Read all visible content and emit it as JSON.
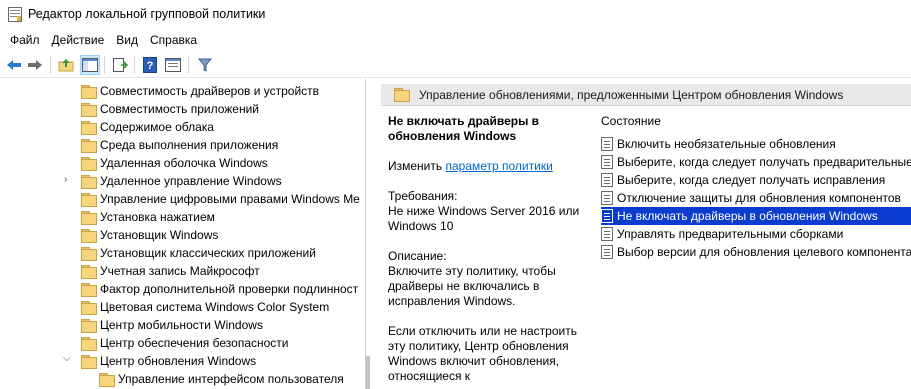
{
  "window": {
    "title": "Редактор локальной групповой политики"
  },
  "menu": {
    "items": [
      "Файл",
      "Действие",
      "Вид",
      "Справка"
    ]
  },
  "toolbar": {
    "buttons": [
      "back-icon",
      "forward-icon",
      "up-folder-icon",
      "show-hide-tree-icon",
      "export-list-icon",
      "help-icon",
      "properties-icon",
      "filter-icon"
    ]
  },
  "tree": {
    "items": [
      {
        "label": "Совместимость драйверов и устройств"
      },
      {
        "label": "Совместимость приложений"
      },
      {
        "label": "Содержимое облака"
      },
      {
        "label": "Среда выполнения приложения"
      },
      {
        "label": "Удаленная оболочка Windows"
      },
      {
        "label": "Удаленное управление Windows"
      },
      {
        "label": "Управление цифровыми правами Windows Me"
      },
      {
        "label": "Установка нажатием"
      },
      {
        "label": "Установщик Windows"
      },
      {
        "label": "Установщик классических приложений"
      },
      {
        "label": "Учетная запись Майкрософт"
      },
      {
        "label": "Фактор дополнительной проверки подлинност"
      },
      {
        "label": "Цветовая система Windows Color System"
      },
      {
        "label": "Центр мобильности Windows"
      },
      {
        "label": "Центр обеспечения безопасности"
      },
      {
        "label": "Центр обновления Windows"
      },
      {
        "label": "Управление интерфейсом пользователя"
      }
    ]
  },
  "right": {
    "header": "Управление обновлениями, предложенными Центром обновления Windows",
    "policy_title": "Не включать драйверы в обновления Windows",
    "edit_prefix": "Изменить ",
    "edit_link": "параметр политики",
    "requirements_label": "Требования:",
    "requirements_text": "Не ниже Windows Server 2016 или Windows 10",
    "description_label": "Описание:",
    "description_text": "Включите эту политику, чтобы драйверы не включались в исправления Windows.",
    "description_more": "Если отключить или не настроить эту политику, Центр обновления Windows включит обновления, относящиеся к",
    "state_header": "Состояние",
    "policies": [
      {
        "label": "Включить необязательные обновления"
      },
      {
        "label": "Выберите, когда следует получать предварительные"
      },
      {
        "label": "Выберите, когда следует получать исправления"
      },
      {
        "label": "Отключение защиты для обновления компонентов"
      },
      {
        "label": "Не включать драйверы в обновления Windows"
      },
      {
        "label": "Управлять предварительными сборками"
      },
      {
        "label": "Выбор версии для обновления целевого компонента"
      }
    ]
  }
}
